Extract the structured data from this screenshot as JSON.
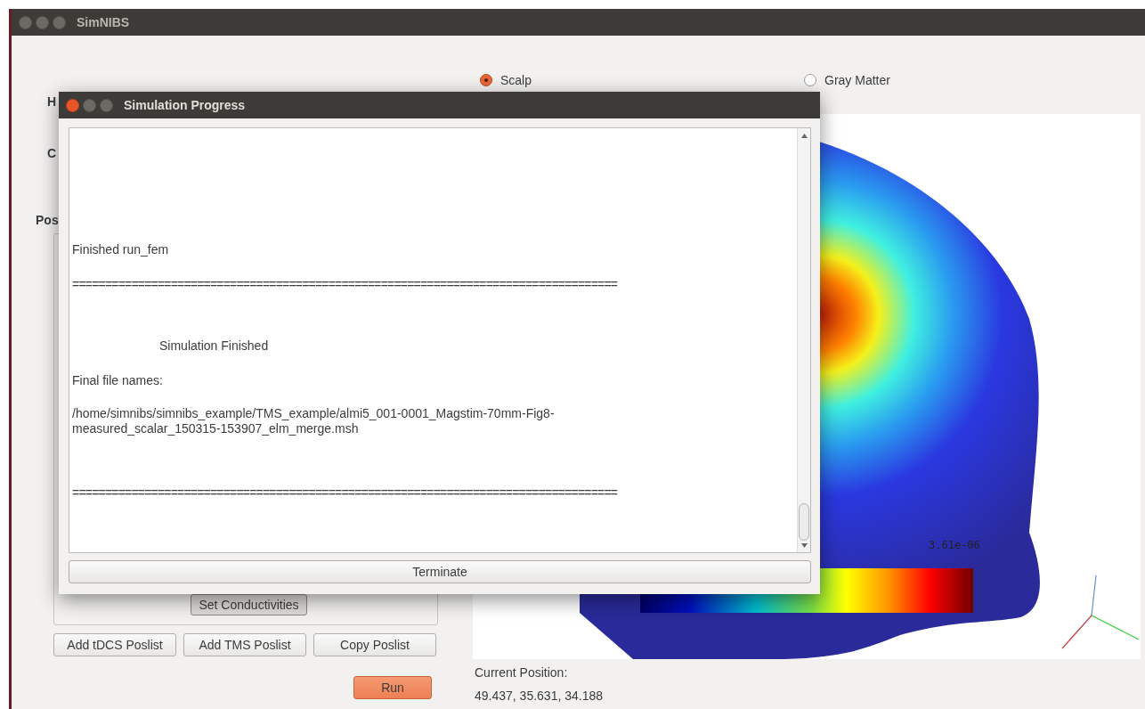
{
  "main_window": {
    "title": "SimNIBS"
  },
  "left_panel": {
    "partial_labels": [
      "H",
      "C",
      "Pos"
    ],
    "set_conductivities_button": "Set Conductivities",
    "poslist_buttons": [
      "Add tDCS Poslist",
      "Add TMS Poslist",
      "Copy Poslist"
    ],
    "run_button": "Run"
  },
  "surface_options": [
    {
      "label": "Scalp",
      "selected": true
    },
    {
      "label": "Gray Matter",
      "selected": false
    }
  ],
  "viewer": {
    "colorbar_max_label": "3.61e-06"
  },
  "current_position": {
    "label": "Current Position:",
    "value": "49.437, 35.631, 34.188"
  },
  "dialog": {
    "title": "Simulation Progress",
    "terminate_button": "Terminate",
    "log_lines": [
      {
        "kind": "text",
        "text": "Finished run_fem"
      },
      {
        "kind": "separator",
        "text": "==================================================================================="
      },
      {
        "kind": "heading",
        "text": "Simulation Finished"
      },
      {
        "kind": "text",
        "text": "Final file names:"
      },
      {
        "kind": "path",
        "text": "/home/simnibs/simnibs_example/TMS_example/almi5_001-0001_Magstim-70mm-Fig8-measured_scalar_150315-153907_elm_merge.msh"
      },
      {
        "kind": "separator",
        "text": "==================================================================================="
      }
    ]
  }
}
